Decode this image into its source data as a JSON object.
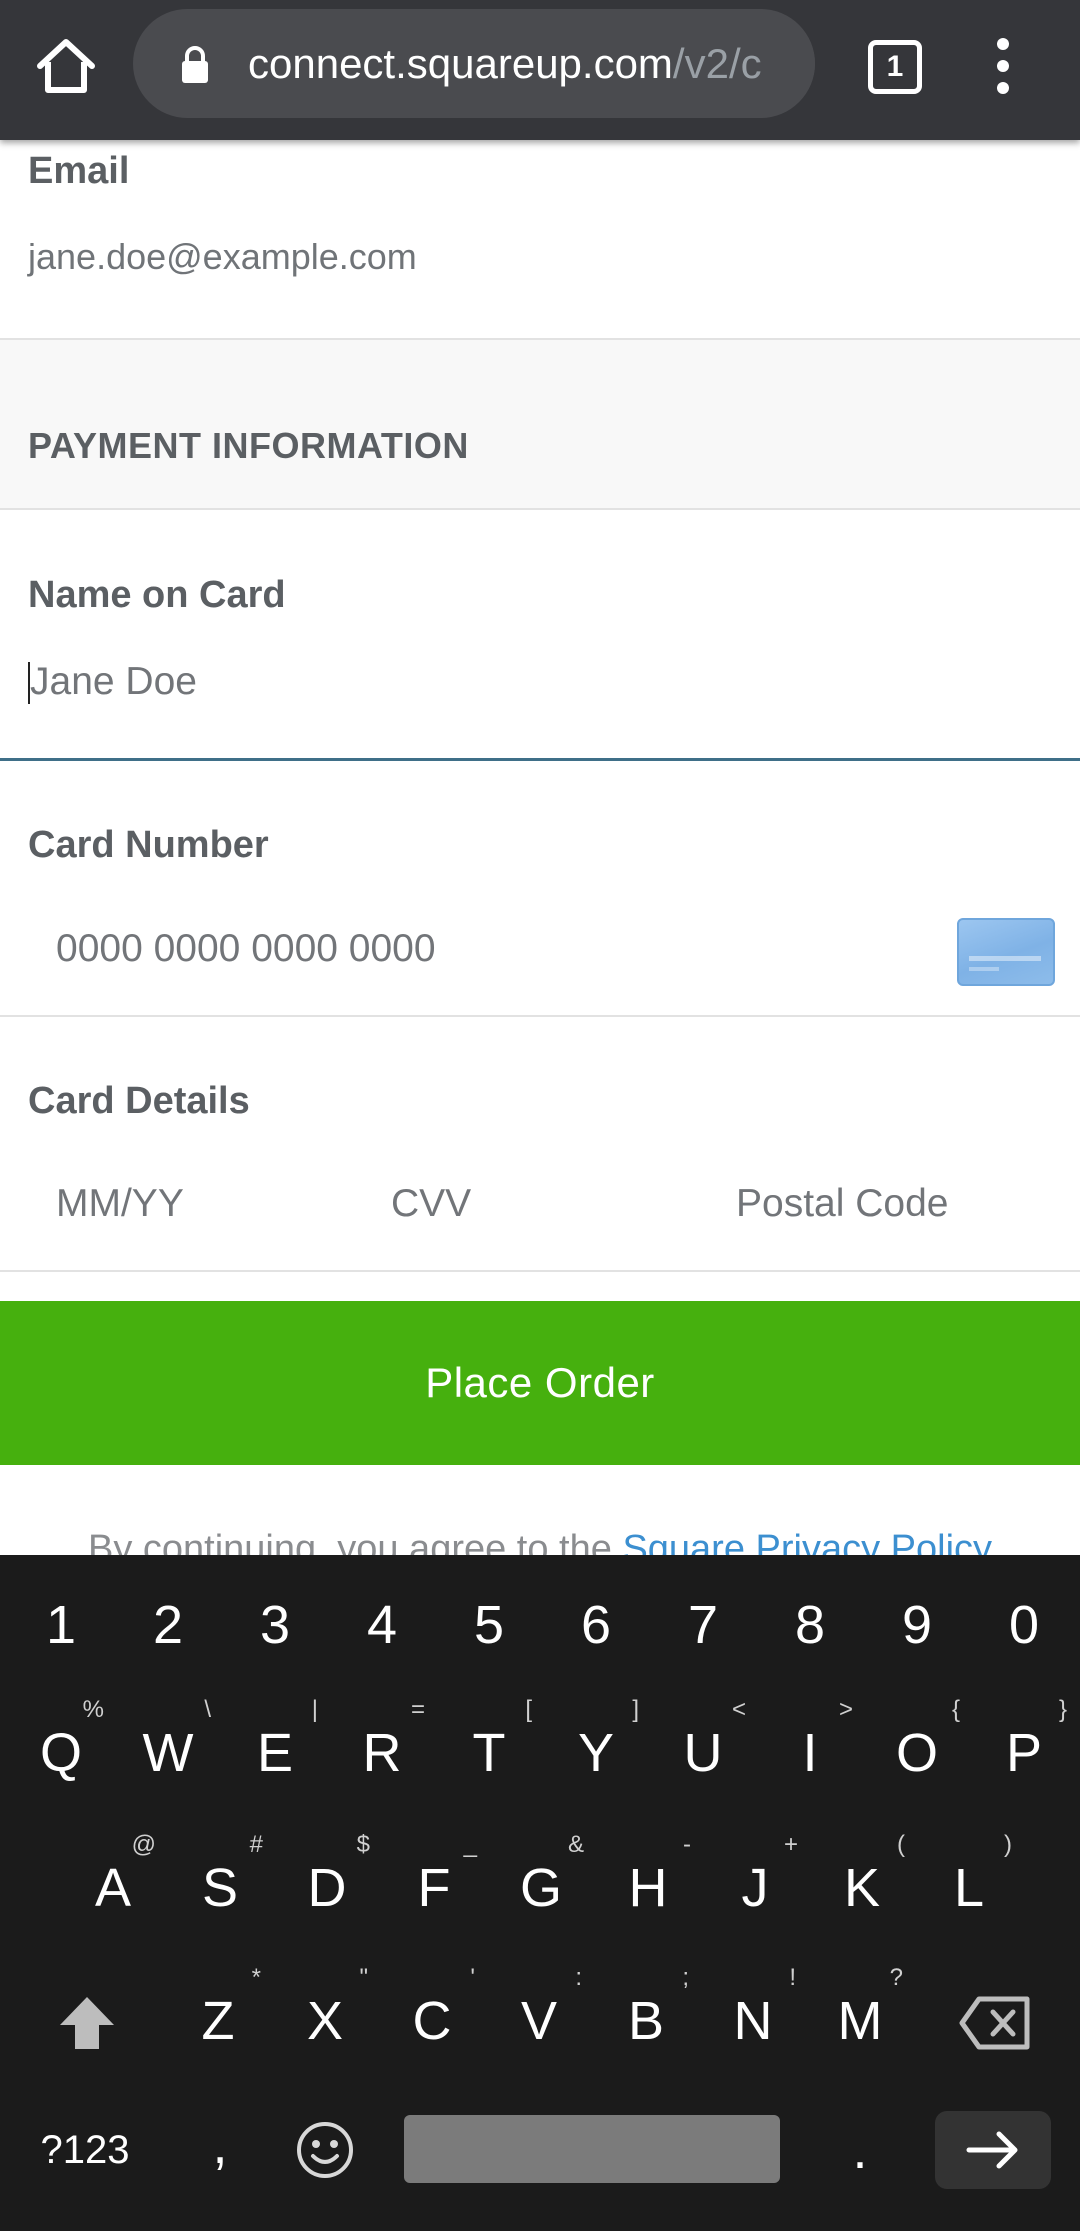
{
  "browser": {
    "url_main": "connect.squareup.com",
    "url_path": "/v2/c",
    "tab_count": "1",
    "icons": [
      "home-icon",
      "lock-icon",
      "tabs-icon",
      "more-vert-icon"
    ]
  },
  "email": {
    "label": "Email",
    "value": "jane.doe@example.com"
  },
  "payment": {
    "section_title": "PAYMENT INFORMATION",
    "name_label": "Name on Card",
    "name_placeholder": "Jane Doe",
    "card_number_label": "Card Number",
    "card_number_placeholder": "0000 0000 0000 0000",
    "card_details_label": "Card Details",
    "expiry_placeholder": "MM/YY",
    "cvv_placeholder": "CVV",
    "postal_placeholder": "Postal Code"
  },
  "button": {
    "label": "Place Order",
    "color": "#46b00e"
  },
  "legal": {
    "prefix": "By continuing, you agree to the ",
    "link": "Square Privacy Policy"
  },
  "keyboard": {
    "row1": [
      "1",
      "2",
      "3",
      "4",
      "5",
      "6",
      "7",
      "8",
      "9",
      "0"
    ],
    "row2": [
      [
        "Q",
        "%"
      ],
      [
        "W",
        "\\"
      ],
      [
        "E",
        "|"
      ],
      [
        "R",
        "="
      ],
      [
        "T",
        "["
      ],
      [
        "Y",
        "]"
      ],
      [
        "U",
        "<"
      ],
      [
        "I",
        ">"
      ],
      [
        "O",
        "{"
      ],
      [
        "P",
        "}"
      ]
    ],
    "row3": [
      [
        "A",
        "@"
      ],
      [
        "S",
        "#"
      ],
      [
        "D",
        "$"
      ],
      [
        "F",
        "_"
      ],
      [
        "G",
        "&"
      ],
      [
        "H",
        "-"
      ],
      [
        "J",
        "+"
      ],
      [
        "K",
        "("
      ],
      [
        "L",
        ")"
      ]
    ],
    "row4": [
      [
        "Z",
        "*"
      ],
      [
        "X",
        "\""
      ],
      [
        "C",
        "'"
      ],
      [
        "V",
        ":"
      ],
      [
        "B",
        ";"
      ],
      [
        "N",
        "!"
      ],
      [
        "M",
        "?"
      ]
    ],
    "symbols_label": "?123",
    "comma": ",",
    "period": "."
  }
}
